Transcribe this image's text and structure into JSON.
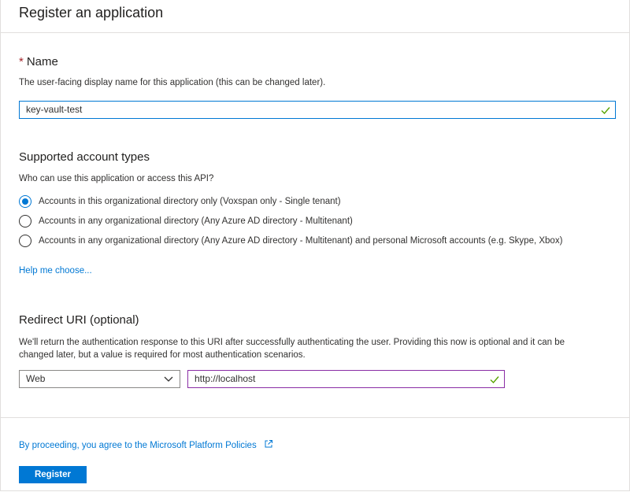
{
  "header": {
    "title": "Register an application"
  },
  "name_section": {
    "required_marker": "*",
    "label": "Name",
    "description": "The user-facing display name for this application (this can be changed later).",
    "value": "key-vault-test"
  },
  "account_types": {
    "label": "Supported account types",
    "description": "Who can use this application or access this API?",
    "options": [
      {
        "label": "Accounts in this organizational directory only (Voxspan only - Single tenant)",
        "selected": true
      },
      {
        "label": "Accounts in any organizational directory (Any Azure AD directory - Multitenant)",
        "selected": false
      },
      {
        "label": "Accounts in any organizational directory (Any Azure AD directory - Multitenant) and personal Microsoft accounts (e.g. Skype, Xbox)",
        "selected": false
      }
    ],
    "help_link": "Help me choose..."
  },
  "redirect": {
    "label": "Redirect URI (optional)",
    "description_line1": "We'll return the authentication response to this URI after successfully authenticating the user. Providing this now is optional and it can be",
    "description_line2": "changed later, but a value is required for most authentication scenarios.",
    "platform": "Web",
    "uri": "http://localhost"
  },
  "footer": {
    "policy_link": "By proceeding, you agree to the Microsoft Platform Policies",
    "register_label": "Register"
  },
  "colors": {
    "accent": "#0078d4",
    "valid_check": "#57a300",
    "redirect_focus_border": "#8a2da5",
    "required": "#a4262c"
  },
  "icons": {
    "valid": "checkmark-icon",
    "dropdown": "chevron-down-icon",
    "external": "external-link-icon"
  }
}
